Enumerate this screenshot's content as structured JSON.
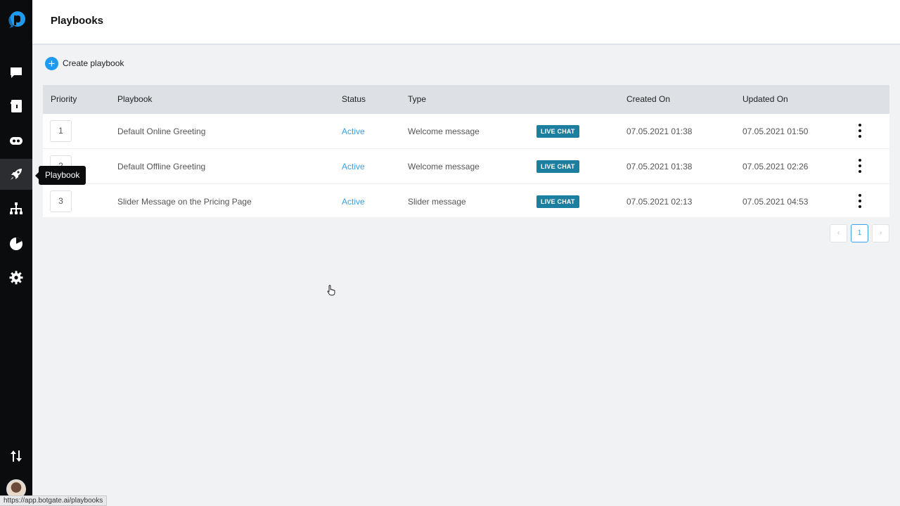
{
  "header": {
    "title": "Playbooks"
  },
  "toolbar": {
    "create_label": "Create playbook"
  },
  "tooltip": "Playbook",
  "sidebar": {
    "items": [
      {
        "name": "chat-icon",
        "active": false
      },
      {
        "name": "contacts-icon",
        "active": false
      },
      {
        "name": "bot-icon",
        "active": false
      },
      {
        "name": "rocket-icon",
        "active": true
      },
      {
        "name": "flow-icon",
        "active": false
      },
      {
        "name": "reports-icon",
        "active": false
      },
      {
        "name": "gear-icon",
        "active": false
      },
      {
        "name": "sort-arrows-icon",
        "active": false
      }
    ]
  },
  "table": {
    "headers": {
      "priority": "Priority",
      "playbook": "Playbook",
      "status": "Status",
      "type": "Type",
      "created": "Created On",
      "updated": "Updated On"
    },
    "rows": [
      {
        "priority": "1",
        "name": "Default Online Greeting",
        "status": "Active",
        "type": "Welcome message",
        "badge": "LIVE CHAT",
        "created": "07.05.2021 01:38",
        "updated": "07.05.2021 01:50"
      },
      {
        "priority": "2",
        "name": "Default Offline Greeting",
        "status": "Active",
        "type": "Welcome message",
        "badge": "LIVE CHAT",
        "created": "07.05.2021 01:38",
        "updated": "07.05.2021 02:26"
      },
      {
        "priority": "3",
        "name": "Slider Message on the Pricing Page",
        "status": "Active",
        "type": "Slider message",
        "badge": "LIVE CHAT",
        "created": "07.05.2021 02:13",
        "updated": "07.05.2021 04:53"
      }
    ]
  },
  "pagination": {
    "prev": "‹",
    "current": "1",
    "next": "›"
  },
  "status_bar_url": "https://app.botgate.ai/playbooks",
  "colors": {
    "accent": "#1e9bf0",
    "badge": "#1c7fa0",
    "sidebar": "#0b0c0e"
  }
}
